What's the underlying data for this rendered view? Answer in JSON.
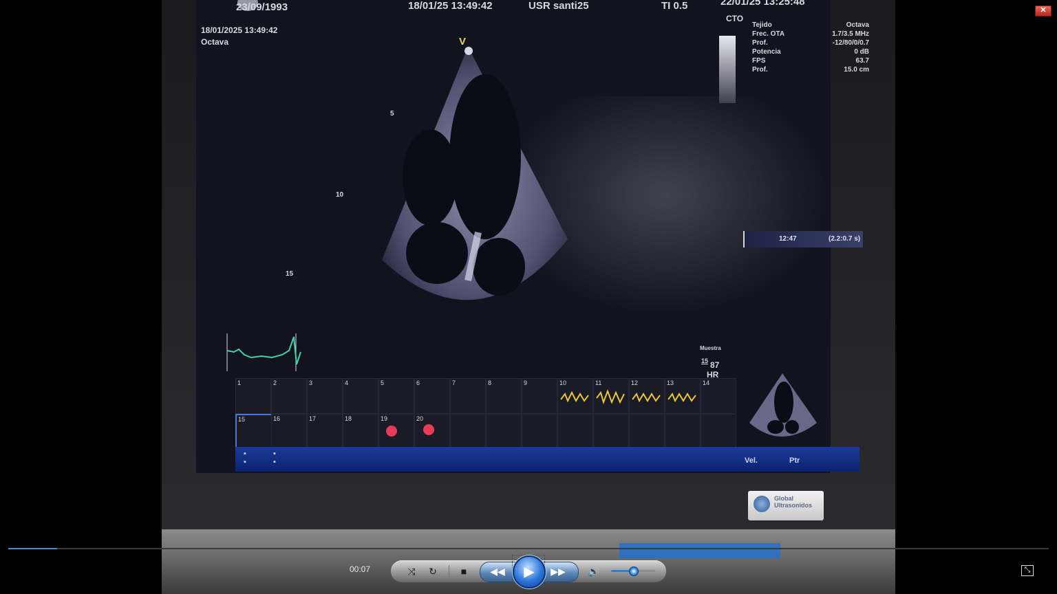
{
  "player": {
    "time": "00:07",
    "progress": 0.047,
    "volume": 0.5,
    "close_icon": "close-icon",
    "controls": [
      "shuffle-icon",
      "repeat-icon",
      "stop-icon",
      "previous-icon",
      "play-icon",
      "next-icon",
      "volume-icon",
      "switch-to-library-icon"
    ]
  },
  "ultrasound": {
    "patient_dob": "23/09/1993",
    "exam_time": "18/01/25 13:49:42",
    "user": "USR santi25",
    "ti": "TI 0.5",
    "date_right": "22/01/25 13:25:48",
    "image_time": "18/01/2025 13:49:42",
    "preset": "Octava",
    "probe_marker": "V",
    "depth_marks": [
      "5",
      "10",
      "15"
    ],
    "scale_label": "CTO",
    "params": [
      {
        "label": "Tejido",
        "value": "Octava"
      },
      {
        "label": "Frec. OTA",
        "value": "1.7/3.5 MHz"
      },
      {
        "label": "Prof.",
        "value": "-12/80/0/0.7"
      },
      {
        "label": "Potencia",
        "value": "0 dB"
      },
      {
        "label": "FPS",
        "value": "63.7"
      },
      {
        "label": "Prof.",
        "value": "15.0 cm"
      }
    ],
    "cine_time": "12:47",
    "cine_range": "(2.2:0.7 s)",
    "hr_value": "87",
    "hr_label": "HR",
    "muestra_label": "Muestra",
    "muestra_value": "15",
    "thumbnail_numbers": [
      "1",
      "2",
      "3",
      "4",
      "5",
      "6",
      "7",
      "8",
      "9",
      "10",
      "11",
      "12",
      "13",
      "14",
      "15",
      "16",
      "17",
      "18",
      "19",
      "20"
    ],
    "bottom_labels": {
      "vel": "Vel.",
      "ptr": "Ptr"
    },
    "badge_text": "Global Ultrasonidos"
  }
}
